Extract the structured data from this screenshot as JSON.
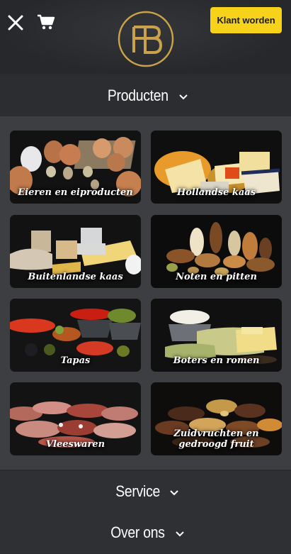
{
  "header": {
    "cta_label": "Klant worden",
    "logo_letter": "FB",
    "brand_color": "#c9a24a",
    "cta_color": "#f6d21a"
  },
  "sections": {
    "producten": "Producten",
    "service": "Service",
    "over_ons": "Over ons"
  },
  "categories": [
    {
      "label": "Eieren en eiproducten"
    },
    {
      "label": "Hollandse kaas"
    },
    {
      "label": "Buitenlandse kaas"
    },
    {
      "label": "Noten en pitten"
    },
    {
      "label": "Tapas"
    },
    {
      "label": "Boters en romen"
    },
    {
      "label": "Vleeswaren"
    },
    {
      "label": "Zuidvruchten en gedroogd fruit"
    }
  ],
  "icons": {
    "close": "close-icon",
    "cart": "cart-icon",
    "chevron": "chevron-down-icon"
  }
}
